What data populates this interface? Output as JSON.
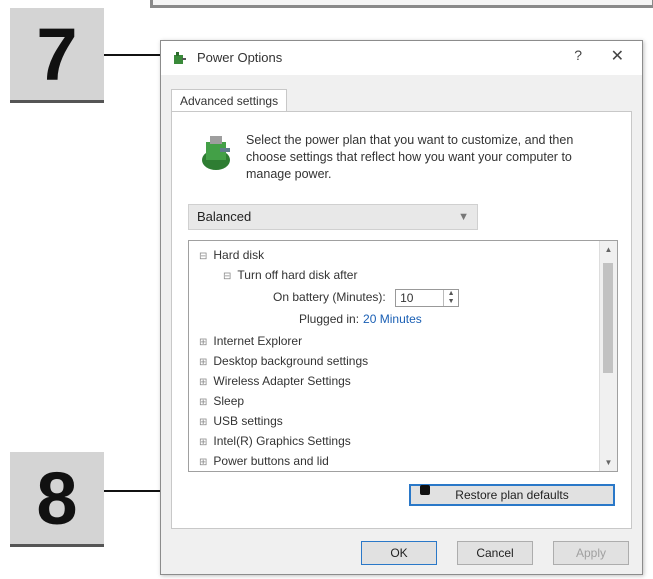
{
  "callouts": {
    "step7": "7",
    "step8": "8"
  },
  "dialog": {
    "title": "Power Options",
    "help_glyph": "?",
    "close_glyph": "✕",
    "tab_label": "Advanced settings",
    "instruction": "Select the power plan that you want to customize, and then choose settings that reflect how you want your computer to manage power.",
    "plan_selected": "Balanced",
    "settings_tree": {
      "hard_disk": "Hard disk",
      "turn_off_after": "Turn off hard disk after",
      "on_battery_label": "On battery (Minutes):",
      "on_battery_value": "10",
      "plugged_in_label": "Plugged in:",
      "plugged_in_value": "20 Minutes",
      "items": [
        "Internet Explorer",
        "Desktop background settings",
        "Wireless Adapter Settings",
        "Sleep",
        "USB settings",
        "Intel(R) Graphics Settings",
        "Power buttons and lid"
      ]
    },
    "restore_label": "Restore plan defaults",
    "ok_label": "OK",
    "cancel_label": "Cancel",
    "apply_label": "Apply"
  },
  "colors": {
    "accent": "#2a78c8",
    "link": "#1a5fb4",
    "callout_bg": "#d4d4d4"
  }
}
